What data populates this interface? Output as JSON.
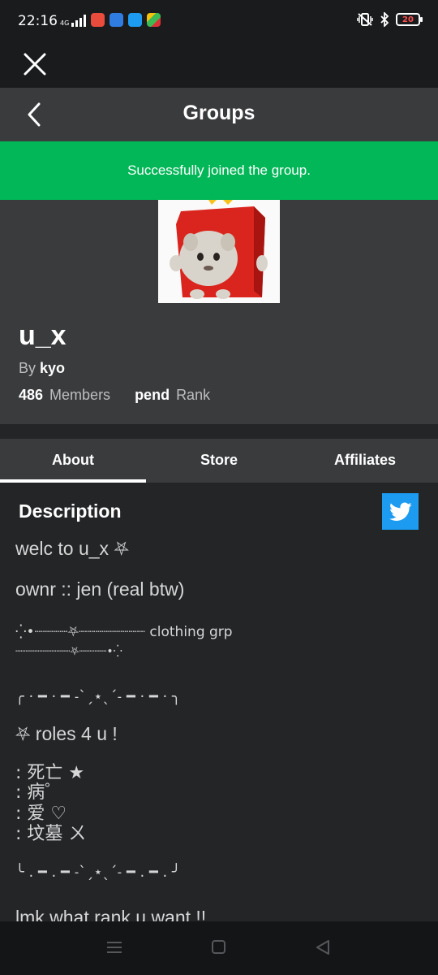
{
  "status_bar": {
    "time": "22:16",
    "network": "4G",
    "battery": "20"
  },
  "header": {
    "title": "Groups"
  },
  "banner": {
    "message": "Successfully joined the group."
  },
  "group": {
    "name": "u_x",
    "by_label": "By",
    "owner": "kyo",
    "members_value": "486",
    "members_label": "Members",
    "rank_value": "pend",
    "rank_label": "Rank"
  },
  "tabs": [
    {
      "label": "About"
    },
    {
      "label": "Store"
    },
    {
      "label": "Affiliates"
    }
  ],
  "description": {
    "title": "Description",
    "lines": [
      "welc to u_x ⛧",
      "ownr :: jen (real btw)",
      "⁛•┈┈┈┈⛧┈┈┈┈┈┈┈┈ clothing grp",
      "┈┈┈┈┈┈┈┈⛧┈┈┈┈•⁛",
      "╭ · ━ · ━ ˗ˋˏ⋆ˎˊ˗ ━ · ━ · ╮",
      "⛧ roles 4 u !",
      ": 死亡 ★",
      ": 病゜",
      ": 爱 ♡",
      ": 坟墓 ㄨ",
      "╰ . ━ . ━ ˗ˋˏ⋆ˎˊ˗ ━ . ━ . ╯",
      "lmk what rank u want !!"
    ]
  },
  "colors": {
    "success_green": "#02b757",
    "header_bg": "#393b3d",
    "page_bg": "#232527",
    "twitter_blue": "#1d9bf0"
  },
  "icons": {
    "close": "close-icon",
    "back": "chevron-left-icon",
    "twitter": "twitter-icon",
    "nav_menu": "menu-icon",
    "nav_home": "square-icon",
    "nav_back": "triangle-back-icon"
  }
}
